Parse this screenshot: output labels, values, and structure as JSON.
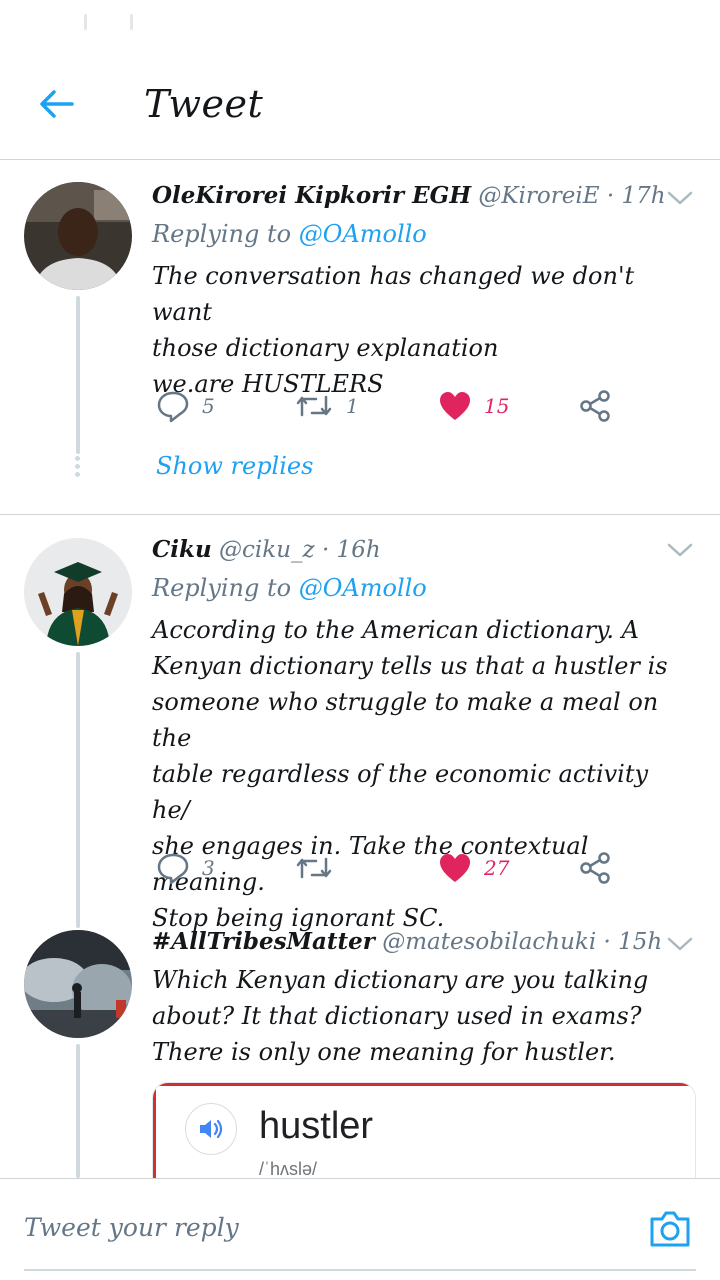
{
  "colors": {
    "accent": "#1da1f2",
    "like": "#e0245e",
    "muted": "#657786",
    "text": "#14171a"
  },
  "header": {
    "title": "Tweet",
    "back_icon": "arrow-left-icon"
  },
  "tweets": [
    {
      "name": "OleKirorei Kipkorir EGH",
      "handle": "@KiroreiE",
      "time": "· 17h",
      "replying_label": "Replying to",
      "replying_to": "@OAmollo",
      "text_lines": [
        "The conversation has changed we don't want",
        "those dictionary explanation",
        "we.are HUSTLERS"
      ],
      "replies": "5",
      "retweets": "1",
      "likes": "15",
      "liked": true,
      "show_replies": "Show replies"
    },
    {
      "name": "Ciku",
      "handle": "@ciku_z",
      "time": "· 16h",
      "replying_label": "Replying to",
      "replying_to": "@OAmollo",
      "text_lines": [
        "According to the American dictionary. A",
        "Kenyan dictionary tells us that a hustler is",
        "someone who struggle to make a meal on the",
        "table regardless of the economic activity he/",
        "she engages in. Take the contextual meaning.",
        "Stop being ignorant SC."
      ],
      "replies": "3",
      "retweets": "",
      "likes": "27",
      "liked": true
    },
    {
      "name": "#AllTribesMatter",
      "handle": "@matesobilachuki",
      "time": "· 15h",
      "text_lines": [
        "Which Kenyan dictionary are you talking",
        "about? It that dictionary used in exams?",
        "There is only one meaning for hustler."
      ],
      "card": {
        "word": "hustler",
        "phonetic": "/ˈhʌslə/",
        "icon": "speaker-icon"
      }
    }
  ],
  "composer": {
    "placeholder": "Tweet your reply",
    "camera_icon": "camera-icon"
  }
}
